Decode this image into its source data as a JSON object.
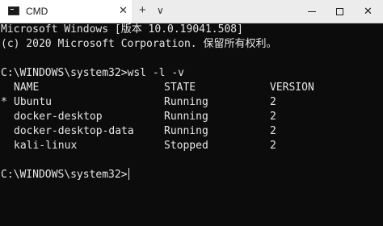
{
  "tab": {
    "title": "CMD",
    "close_glyph": "✕",
    "new_tab_glyph": "+",
    "dropdown_glyph": "∨",
    "icon": "terminal-icon"
  },
  "window_controls": {
    "close_glyph": "✕"
  },
  "console": {
    "header_line1": "Microsoft Windows [版本 10.0.19041.508]",
    "header_line2": "(c) 2020 Microsoft Corporation. 保留所有权利。",
    "command": "C:\\WINDOWS\\system32>wsl -l -v",
    "columns": {
      "name": "NAME",
      "state": "STATE",
      "version": "VERSION"
    },
    "rows": [
      {
        "marker": "*",
        "name": "Ubuntu",
        "state": "Running",
        "version": "2"
      },
      {
        "marker": "",
        "name": "docker-desktop",
        "state": "Running",
        "version": "2"
      },
      {
        "marker": "",
        "name": "docker-desktop-data",
        "state": "Running",
        "version": "2"
      },
      {
        "marker": "",
        "name": "kali-linux",
        "state": "Stopped",
        "version": "2"
      }
    ],
    "prompt": "C:\\WINDOWS\\system32>"
  }
}
